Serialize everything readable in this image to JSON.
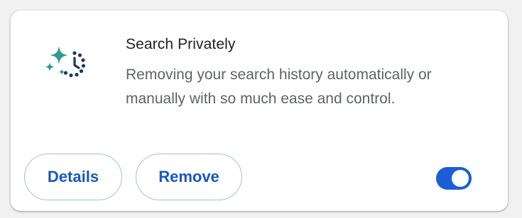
{
  "extension": {
    "icon": "sparkle-clock-icon",
    "title": "Search Privately",
    "description": "Removing your search history automatically or manually with so much ease and control.",
    "enabled": true
  },
  "actions": {
    "details_label": "Details",
    "remove_label": "Remove"
  },
  "colors": {
    "accent": "#1b5ed6",
    "button_text": "#1a56c4",
    "button_border": "#a9bde3",
    "icon_teal": "#2f9a8f",
    "icon_navy": "#1f3a5f"
  }
}
